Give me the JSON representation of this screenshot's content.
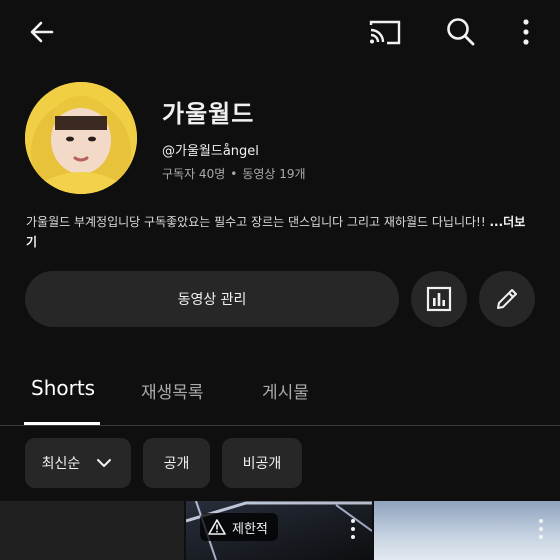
{
  "channel": {
    "name": "가울월드",
    "handle": "@가울월드ångel",
    "subscribers": "구독자 40명",
    "video_count": "동영상 19개",
    "description": "가울월드 부계정입니당 구독좋았요는 필수고 장르는 댄스입니다 그리고 재하월드 다닙니다!! ",
    "description_more": "...더보기"
  },
  "actions": {
    "manage_videos": "동영상 관리"
  },
  "tabs": [
    {
      "label": "Shorts",
      "active": true
    },
    {
      "label": "재생목록",
      "active": false
    },
    {
      "label": "게시물",
      "active": false
    }
  ],
  "filters": {
    "sort": "최신순",
    "public": "공개",
    "private": "비공개"
  },
  "thumbnails": {
    "restricted_label": "제한적"
  },
  "icons": [
    "arrow-back-icon",
    "cast-icon",
    "search-icon",
    "more-vert-icon",
    "analytics-icon",
    "edit-pencil-icon",
    "chevron-down-icon",
    "warning-icon"
  ],
  "colors": {
    "background": "#0f0f0f",
    "surface": "#272727",
    "avatar_raincoat": "#f2d24a",
    "text_primary": "#f1f1f1",
    "text_secondary": "#aaaaaa"
  }
}
